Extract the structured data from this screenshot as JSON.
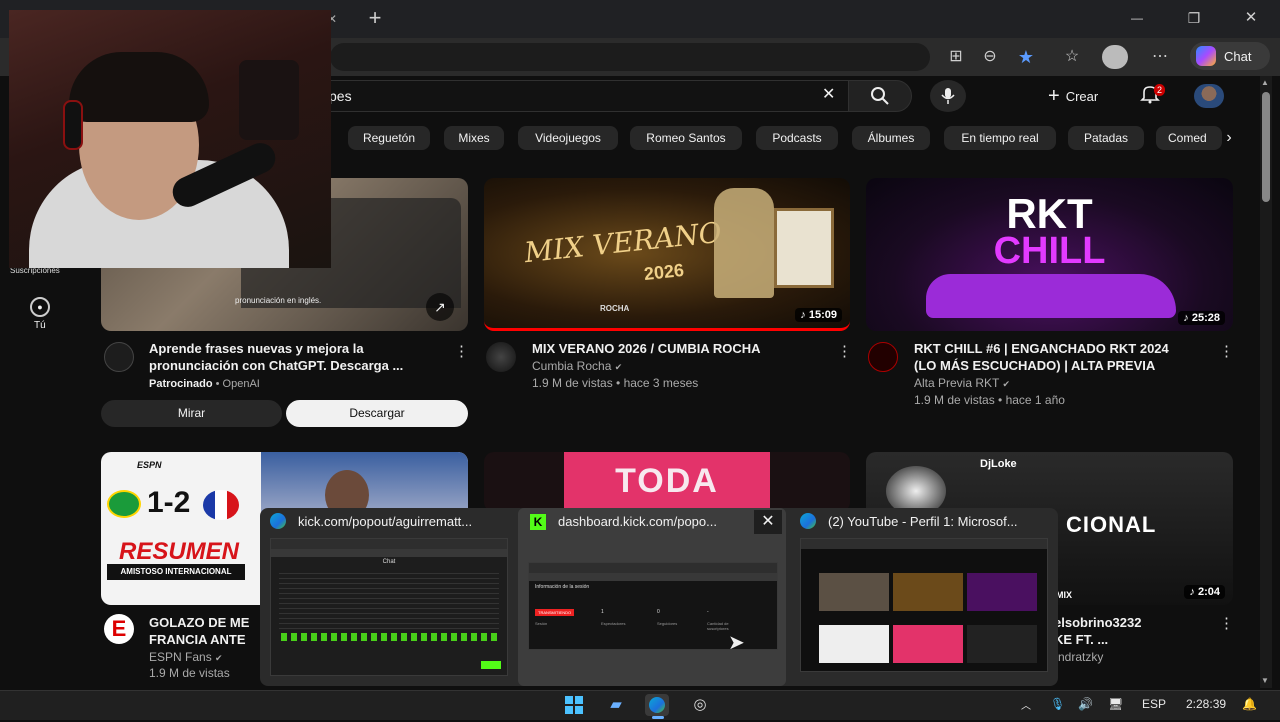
{
  "browser": {
    "new_tab": "+",
    "minimize": "—",
    "restore": "❐",
    "close": "✕",
    "chat_label": "Chat"
  },
  "youtube": {
    "search_value": "pes",
    "search_clear": "✕",
    "create_label": "Crear",
    "notif_count": "2",
    "chips": [
      "Reguetón",
      "Mixes",
      "Videojuegos",
      "Romeo Santos",
      "Podcasts",
      "Álbumes",
      "En tiempo real",
      "Patadas",
      "Comed"
    ],
    "sidebar": {
      "subs": "Suscripciones",
      "you": "Tú"
    },
    "ad": {
      "overlay_text": "pronunciación en inglés.",
      "title_l1": "Aprende frases nuevas y mejora la",
      "title_l2": "pronunciación con ChatGPT. Descarga ...",
      "sponsored": "Patrocinado",
      "advertiser": "OpenAI",
      "btn_watch": "Mirar",
      "btn_download": "Descargar"
    },
    "videos": [
      {
        "thumb_text_1": "MIX VERANO",
        "thumb_text_2": "2026",
        "thumb_sign": "ROCHA",
        "duration": "15:09",
        "title": "MIX VERANO 2026 / CUMBIA ROCHA",
        "channel": "Cumbia Rocha",
        "stats": "1.9 M de vistas • hace 3 meses"
      },
      {
        "thumb_text_1": "RKT",
        "thumb_text_2": "CHILL",
        "duration": "25:28",
        "title_l1": "RKT CHILL #6 | ENGANCHADO RKT 2024",
        "title_l2": "(LO MÁS ESCUCHADO) | ALTA PREVIA",
        "channel": "Alta Previa RKT",
        "stats": "1.9 M de vistas • hace 1 año"
      },
      {
        "score": "1-2",
        "banner_1": "RESUMEN",
        "banner_2": "AMISTOSO INTERNACIONAL",
        "brand": "ESPN",
        "title_l1": "GOLAZO DE ME",
        "title_l2": "FRANCIA ANTE",
        "channel": "ESPN Fans",
        "stats": "1.9 M de vistas"
      },
      {
        "thumb_text": "TODA"
      },
      {
        "thumb_text": "DjLoke",
        "thumb_text_2": "CIONAL",
        "tag": "MIX",
        "duration": "2:04",
        "title_l1": "elsobrino3232",
        "title_l2": "KE FT. ...",
        "channel": "ndratzky"
      }
    ]
  },
  "switcher": {
    "windows": [
      {
        "title": "kick.com/popout/aguirrematt...",
        "preview_header": "Chat"
      },
      {
        "title": "dashboard.kick.com/popo...",
        "preview_header": "Información de la sesión",
        "live_badge": "TRANSMITIENDO",
        "col_1": "Sesión",
        "col_2": "Espectadores",
        "col_3": "Seguidores",
        "col_4": "Cantidad de suscriptores",
        "val_1": "1",
        "val_2": "0",
        "val_3": "-"
      },
      {
        "title": "(2) YouTube - Perfil 1: Microsof..."
      }
    ],
    "close": "✕"
  },
  "taskbar": {
    "language": "ESP",
    "time": "2:28:39"
  },
  "colors": {
    "youtube_bg": "#0f0f0f",
    "accent_red": "#cc0000",
    "kick_green": "#53fc18",
    "chip_bg": "#272727"
  }
}
